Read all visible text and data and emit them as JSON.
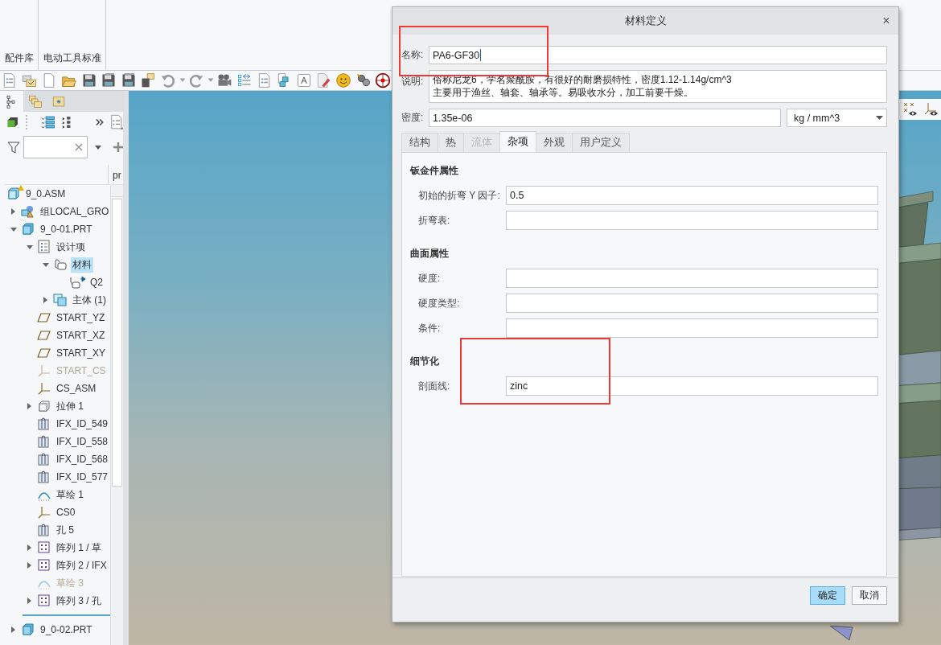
{
  "ribbon": {
    "groups": [
      {
        "label": "配件库"
      },
      {
        "label": "电动工具标准"
      }
    ]
  },
  "model_tree": {
    "panel_tabs": [
      {
        "kind": "tree",
        "selected": true
      },
      {
        "kind": "layers",
        "selected": false
      },
      {
        "kind": "favorites",
        "selected": false
      }
    ],
    "column_2": "pr",
    "items": [
      {
        "label": "9_0.ASM",
        "kind": "asm",
        "selected": false,
        "dimmed": false,
        "warning": true,
        "children": [
          {
            "label": "组LOCAL_GRO",
            "kind": "group",
            "expanded": false,
            "selected": false,
            "dimmed": false
          },
          {
            "label": "9_0-01.PRT",
            "kind": "part",
            "expanded": true,
            "selected": false,
            "dimmed": false,
            "drop_marker_after": true,
            "children": [
              {
                "label": "设计项",
                "kind": "design-items",
                "expanded": true,
                "selected": false,
                "dimmed": false,
                "children": [
                  {
                    "label": "材料",
                    "kind": "material",
                    "expanded": true,
                    "selected": true,
                    "dimmed": false,
                    "children": [
                      {
                        "label": "Q2",
                        "kind": "material-ref",
                        "selected": false,
                        "dimmed": false
                      }
                    ]
                  },
                  {
                    "label": "主体 (1)",
                    "kind": "body",
                    "expanded": false,
                    "selected": false,
                    "dimmed": false
                  }
                ]
              },
              {
                "label": "START_YZ",
                "kind": "plane",
                "selected": false,
                "dimmed": false
              },
              {
                "label": "START_XZ",
                "kind": "plane",
                "selected": false,
                "dimmed": false
              },
              {
                "label": "START_XY",
                "kind": "plane",
                "selected": false,
                "dimmed": false
              },
              {
                "label": "START_CS",
                "kind": "csys",
                "selected": false,
                "dimmed": true
              },
              {
                "label": "CS_ASM",
                "kind": "csys",
                "selected": false,
                "dimmed": false
              },
              {
                "label": "拉伸 1",
                "kind": "extrude",
                "expanded": false,
                "selected": false,
                "dimmed": false
              },
              {
                "label": "IFX_ID_549",
                "kind": "ifx",
                "selected": false,
                "dimmed": false
              },
              {
                "label": "IFX_ID_558",
                "kind": "ifx",
                "selected": false,
                "dimmed": false
              },
              {
                "label": "IFX_ID_568",
                "kind": "ifx",
                "selected": false,
                "dimmed": false
              },
              {
                "label": "IFX_ID_577",
                "kind": "ifx",
                "selected": false,
                "dimmed": false
              },
              {
                "label": "草绘 1",
                "kind": "sketch",
                "selected": false,
                "dimmed": false
              },
              {
                "label": "CS0",
                "kind": "csys",
                "selected": false,
                "dimmed": false
              },
              {
                "label": "孔 5",
                "kind": "ifx",
                "selected": false,
                "dimmed": false
              },
              {
                "label": "阵列 1 / 草",
                "kind": "pattern",
                "expanded": false,
                "selected": false,
                "dimmed": false
              },
              {
                "label": "阵列 2 / IFX",
                "kind": "pattern",
                "expanded": false,
                "selected": false,
                "dimmed": false
              },
              {
                "label": "草绘 3",
                "kind": "sketch",
                "selected": false,
                "dimmed": true
              },
              {
                "label": "阵列 3 / 孔",
                "kind": "pattern",
                "expanded": false,
                "selected": false,
                "dimmed": false
              }
            ]
          },
          {
            "label": "9_0-02.PRT",
            "kind": "part",
            "expanded": false,
            "selected": false,
            "dimmed": false
          }
        ]
      }
    ]
  },
  "dialog": {
    "title": "材料定义",
    "close": "×",
    "name": {
      "label": "名称:",
      "value": "PA6-GF30",
      "focused": true
    },
    "description": {
      "label": "说明:",
      "lines": [
        "俗称尼龙6，学名聚酰胺，有很好的耐磨损特性，密度1.12-1.14g/cm^3",
        "主要用于渔丝、轴套、轴承等。易吸收水分，加工前要干燥。"
      ]
    },
    "density": {
      "label": "密度:",
      "value": "1.35e-06",
      "unit": "kg / mm^3"
    },
    "tabs": [
      {
        "label": "结构",
        "selected": false,
        "disabled": false
      },
      {
        "label": "热",
        "selected": false,
        "disabled": false
      },
      {
        "label": "流体",
        "selected": false,
        "disabled": true
      },
      {
        "label": "杂项",
        "selected": true,
        "disabled": false
      },
      {
        "label": "外观",
        "selected": false,
        "disabled": false
      },
      {
        "label": "用户定义",
        "selected": false,
        "disabled": false
      }
    ],
    "sections": [
      {
        "title": "钣金件属性",
        "fields": [
          {
            "label": "初始的折弯 Y 因子:",
            "value": "0.5"
          },
          {
            "label": "折弯表:"
          }
        ]
      },
      {
        "title": "曲面属性",
        "fields": [
          {
            "label": "硬度:"
          },
          {
            "label": "硬度类型:"
          },
          {
            "label": "条件:"
          }
        ]
      },
      {
        "title": "细节化",
        "fields": [
          {
            "label": "剖面线:",
            "value": "zinc"
          }
        ]
      }
    ],
    "buttons": [
      {
        "label": "确定",
        "selected": true
      },
      {
        "label": "取消",
        "selected": false
      }
    ]
  }
}
